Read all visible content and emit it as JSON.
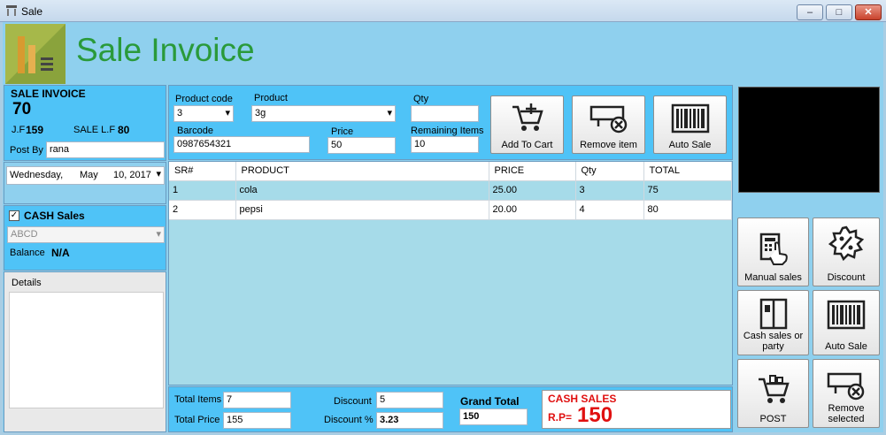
{
  "window": {
    "title": "Sale",
    "min": "–",
    "max": "□",
    "close": "✕"
  },
  "header": {
    "title": "Sale Invoice"
  },
  "invoice": {
    "label": "SALE INVOICE",
    "number": "70",
    "jf_label": "J.F",
    "jf_value": "159",
    "salelf_label": "SALE L.F",
    "salelf_value": "80",
    "postby_label": "Post By",
    "postby_value": "rana"
  },
  "date": {
    "weekday": "Wednesday,",
    "month": "May",
    "day_year": "10, 2017"
  },
  "cash": {
    "label": "CASH Sales",
    "checked": true,
    "party_placeholder": "ABCD",
    "balance_label": "Balance",
    "balance_value": "N/A"
  },
  "details": {
    "label": "Details"
  },
  "entry": {
    "product_code_label": "Product code",
    "product_code_value": "3",
    "product_label": "Product",
    "product_value": "3g",
    "qty_label": "Qty",
    "qty_value": "",
    "barcode_label": "Barcode",
    "barcode_value": "0987654321",
    "price_label": "Price",
    "price_value": "50",
    "remaining_label": "Remaining Items",
    "remaining_value": "10"
  },
  "buttons": {
    "add_to_cart": "Add To Cart",
    "remove_item": "Remove item",
    "auto_sale_top": "Auto Sale",
    "manual_sales": "Manual sales",
    "discount": "Discount",
    "cash_sales_party": "Cash sales or party",
    "auto_sale": "Auto Sale",
    "post": "POST",
    "remove_selected": "Remove selected"
  },
  "table": {
    "headers": [
      "SR#",
      "PRODUCT",
      "PRICE",
      "Qty",
      "TOTAL"
    ],
    "rows": [
      [
        "1",
        "cola",
        "25.00",
        "3",
        "75"
      ],
      [
        "2",
        "pepsi",
        "20.00",
        "4",
        "80"
      ]
    ]
  },
  "totals": {
    "total_items_label": "Total Items",
    "total_items_value": "7",
    "total_price_label": "Total Price",
    "total_price_value": "155",
    "discount_label": "Discount",
    "discount_value": "5",
    "discount_pct_label": "Discount %",
    "discount_pct_value": "3.23",
    "grand_total_label": "Grand Total",
    "grand_total_value": "150",
    "cash_sales_title": "CASH SALES",
    "rp_label": "R.P=",
    "rp_value": "150"
  },
  "colors": {
    "accent_blue": "#4fc3f7",
    "title_green": "#2a9a3a",
    "cash_red": "#e01010"
  }
}
